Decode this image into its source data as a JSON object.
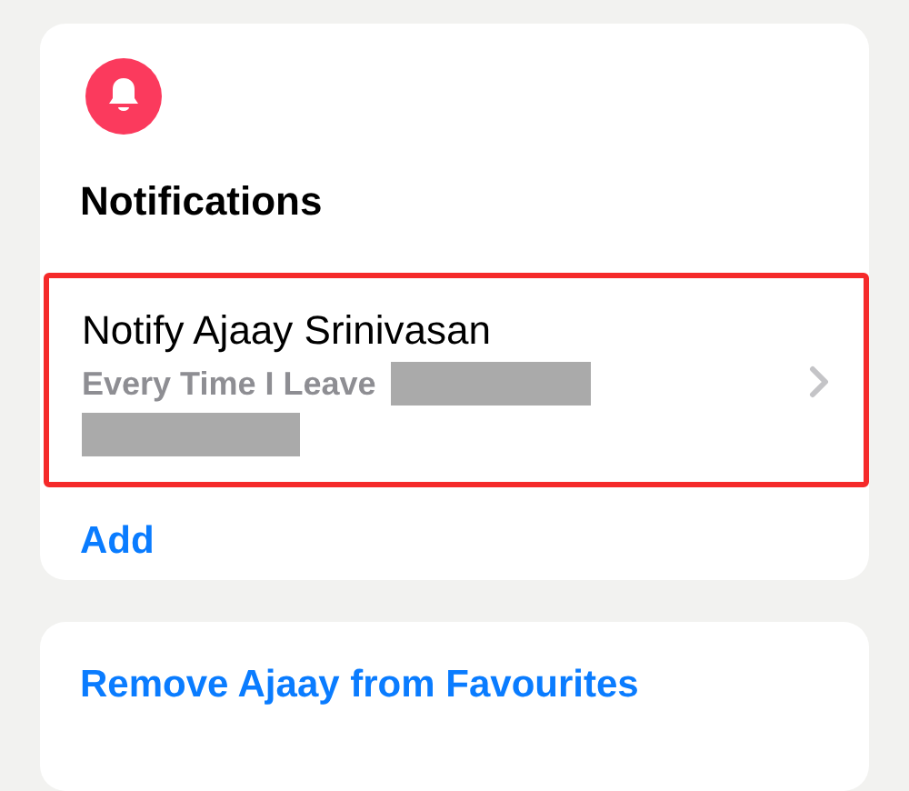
{
  "notifications_card": {
    "title": "Notifications",
    "items": [
      {
        "title": "Notify Ajaay Srinivasan",
        "subtitle": "Every Time I Leave",
        "highlighted": true
      }
    ],
    "add_link": "Add"
  },
  "actions_card": {
    "items": [
      "Remove Ajaay from Favourites"
    ]
  }
}
